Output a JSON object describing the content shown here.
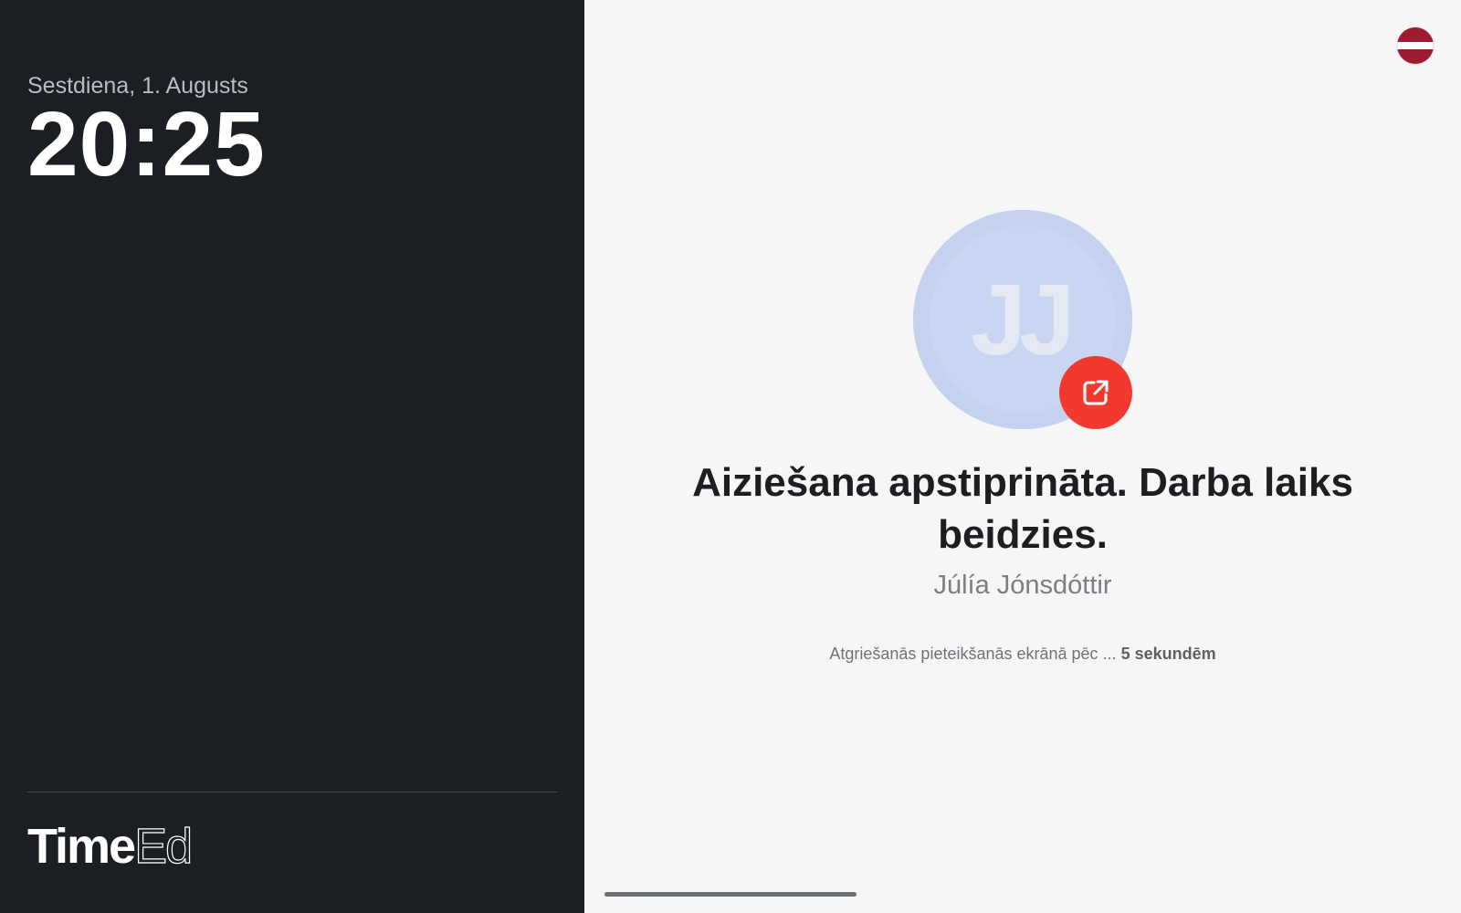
{
  "sidebar": {
    "date": "Sestdiena, 1. Augusts",
    "time": "20:25",
    "logo": {
      "bold_part": "Time",
      "thin_part": "Ed"
    }
  },
  "main": {
    "language_flag": "latvia-flag-icon",
    "avatar_initials": "JJ",
    "badge_icon": "external-link-icon",
    "headline": "Aiziešana apstiprināta. Darba laiks beidzies.",
    "employee_name": "Júlía Jónsdóttir",
    "countdown_prefix": "Atgriešanās pieteikšanās ekrānā pēc ...",
    "countdown_value": "5 sekundēm"
  },
  "colors": {
    "sidebar_bg": "#1b1e22",
    "main_bg": "#f6f6f6",
    "avatar_bg": "#c9d6f1",
    "badge_bg": "#f1392f",
    "flag_red": "#9e1b32"
  }
}
